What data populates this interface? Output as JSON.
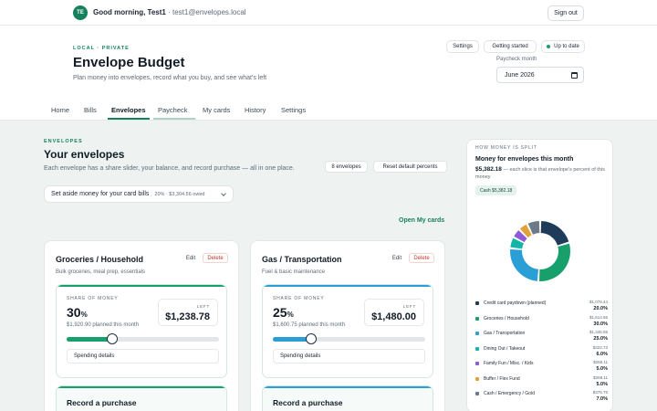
{
  "user": {
    "initials": "TE",
    "greeting": "Good morning, Test1",
    "email": " · test1@envelopes.local",
    "signout_label": "Sign out"
  },
  "header": {
    "eyebrow": "LOCAL · PRIVATE",
    "title": "Envelope Budget",
    "subtitle": "Plan money into envelopes, record what you buy, and see what's left",
    "settings_label": "Settings",
    "getting_started_label": "Getting started",
    "status_label": "Up to date",
    "paycheck_month_label": "Paycheck month",
    "paycheck_month_value": "June 2026"
  },
  "tabs": [
    {
      "label": "Home"
    },
    {
      "label": "Bills"
    },
    {
      "label": "Envelopes",
      "active": true
    },
    {
      "label": "Paycheck"
    },
    {
      "label": "My cards"
    },
    {
      "label": "History"
    },
    {
      "label": "Settings"
    }
  ],
  "section": {
    "eyebrow": "ENVELOPES",
    "title": "Your envelopes",
    "description": "Each envelope has a share slider, your balance, and record purchase — all in one place.",
    "count_badge": "8 envelopes",
    "reset_label": "Reset default percents",
    "setaside_label": "Set aside money for your card bills",
    "setaside_meta": "20% · $3,304.56 owed",
    "open_cards_label": "Open My cards"
  },
  "envelopes": [
    {
      "name": "Groceries / Household",
      "description": "Bulk groceries, meal prep, essentials",
      "edit_label": "Edit",
      "delete_label": "Delete",
      "share_label": "SHARE OF MONEY",
      "percent": "30",
      "percent_unit": "%",
      "planned": "$1,920.90 planned this month",
      "left_label": "LEFT",
      "left_value": "$1,238.78",
      "share_fraction": 0.3,
      "accent": "#17a06c",
      "details_label": "Spending details",
      "record_label": "Record a purchase"
    },
    {
      "name": "Gas / Transportation",
      "description": "Fuel & basic maintenance",
      "edit_label": "Edit",
      "delete_label": "Delete",
      "share_label": "SHARE OF MONEY",
      "percent": "25",
      "percent_unit": "%",
      "planned": "$1,600.75 planned this month",
      "left_label": "LEFT",
      "left_value": "$1,480.00",
      "share_fraction": 0.25,
      "accent": "#2a9fd6",
      "details_label": "Spending details",
      "record_label": "Record a purchase"
    }
  ],
  "split_panel": {
    "eyebrow": "HOW MONEY IS SPLIT",
    "heading": "Money for envelopes this month",
    "amount": "$5,382.18",
    "amount_suffix": " — each slice is that envelope's percent of this money",
    "cash_pill": "Cash $5,382.18"
  },
  "chart_data": {
    "type": "pie",
    "title": "",
    "legend_placement": "bottom",
    "categories": [
      "Credit card paydown (planned)",
      "Groceries / Household",
      "Gas / Transportation",
      "Dining Out / Takeout",
      "Family Fun / Misc. / Kids",
      "Buffer / Flex Fund",
      "Cash / Emergency / Gold"
    ],
    "amounts": [
      "$1,076.44",
      "$1,614.65",
      "$1,345.55",
      "$322.73",
      "$269.11",
      "$269.11",
      "$376.75"
    ],
    "percent_labels": [
      "20.0%",
      "30.0%",
      "25.0%",
      "6.0%",
      "5.0%",
      "5.0%",
      "7.0%"
    ],
    "values": [
      20,
      30,
      25,
      6,
      5,
      5,
      7
    ],
    "colors": [
      "#1f3b5a",
      "#17a06c",
      "#2a9fd6",
      "#13b5a8",
      "#8e5bd6",
      "#e1a23a",
      "#6b7a86"
    ]
  }
}
